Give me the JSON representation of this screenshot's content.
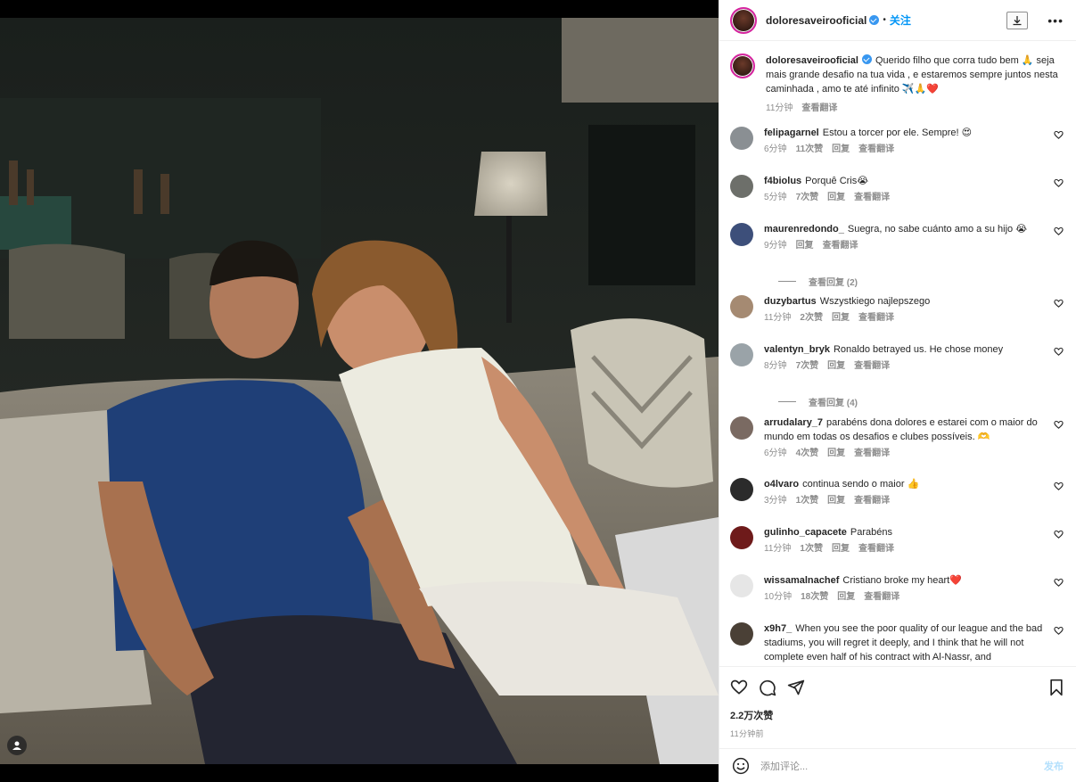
{
  "header": {
    "username": "doloresaveirooficial",
    "separator": "•",
    "follow_label": "关注"
  },
  "caption": {
    "username": "doloresaveirooficial",
    "text": "Querido filho que corra tudo bem 🙏 seja mais grande desafio na tua vida , e estaremos sempre juntos nesta caminhada , amo te até infinito ✈️🙏❤️",
    "time": "11分钟",
    "translate": "查看翻译"
  },
  "comments": [
    {
      "user": "felipagarnel",
      "text": "Estou a torcer por ele. Sempre! 😍",
      "time": "6分钟",
      "likes": "11次赞",
      "reply": "回复",
      "translate": "查看翻译",
      "avatar_color": "#8a8f93"
    },
    {
      "user": "f4biolus",
      "text": "Porquê Cris😭",
      "time": "5分钟",
      "likes": "7次赞",
      "reply": "回复",
      "translate": "查看翻译",
      "avatar_color": "#6d6f6a"
    },
    {
      "user": "maurenredondo_",
      "text": "Suegra, no sabe cuánto amo a su hijo 😭",
      "time": "9分钟",
      "likes": "",
      "reply": "回复",
      "translate": "查看翻译",
      "avatar_color": "#3d4f7a",
      "view_replies": "查看回复 (2)"
    },
    {
      "user": "duzybartus",
      "text": "Wszystkiego najlepszego",
      "time": "11分钟",
      "likes": "2次赞",
      "reply": "回复",
      "translate": "查看翻译",
      "avatar_color": "#a58a72"
    },
    {
      "user": "valentyn_bryk",
      "text": "Ronaldo betrayed us. He chose money",
      "time": "8分钟",
      "likes": "7次赞",
      "reply": "回复",
      "translate": "查看翻译",
      "avatar_color": "#9aa3a8",
      "view_replies": "查看回复 (4)"
    },
    {
      "user": "arrudalary_7",
      "text": "parabéns dona dolores e estarei com o maior do mundo em todas os desafios e clubes possíveis. 🫶",
      "time": "6分钟",
      "likes": "4次赞",
      "reply": "回复",
      "translate": "查看翻译",
      "avatar_color": "#7a6a62"
    },
    {
      "user": "o4lvaro",
      "text": "continua sendo o maior 👍",
      "time": "3分钟",
      "likes": "1次赞",
      "reply": "回复",
      "translate": "查看翻译",
      "avatar_color": "#2b2b2b"
    },
    {
      "user": "gulinho_capacete",
      "text": "Parabéns",
      "time": "11分钟",
      "likes": "1次赞",
      "reply": "回复",
      "translate": "查看翻译",
      "avatar_color": "#6e1a1a"
    },
    {
      "user": "wissamalnachef",
      "text": "Cristiano broke my heart❤️",
      "time": "10分钟",
      "likes": "18次赞",
      "reply": "回复",
      "translate": "查看翻译",
      "avatar_color": "#e6e6e6"
    },
    {
      "user": "x9h7_",
      "text": "When you see the poor quality of our league and the bad stadiums, you will regret it deeply, and I think that he will not complete even half of his contract with Al-Nassr, and",
      "time": "",
      "likes": "",
      "reply": "",
      "translate": "",
      "avatar_color": "#4a4036"
    }
  ],
  "stats": {
    "views": "2.2万次赞",
    "posted": "11分钟前"
  },
  "add_comment": {
    "placeholder": "添加评论...",
    "post_label": "发布"
  },
  "colors": {
    "accent": "#0095f6",
    "verified": "#3897f0",
    "muted": "#8e8e8e",
    "heart_red": "#ed4956"
  },
  "icons": [
    "tag-icon",
    "verified-icon",
    "download-icon",
    "more-icon",
    "heart-icon",
    "comment-icon",
    "share-icon",
    "bookmark-icon",
    "emoji-icon"
  ]
}
